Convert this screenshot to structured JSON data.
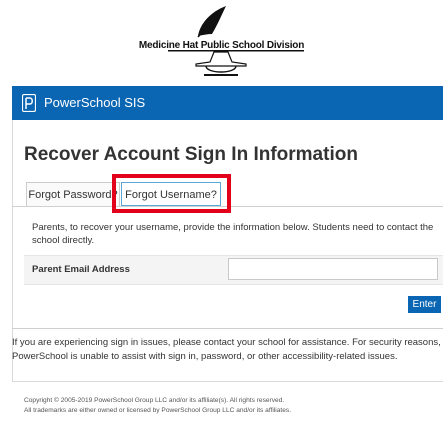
{
  "district": {
    "name": "Medicine Hat Public School Division"
  },
  "header": {
    "brand": "PowerSchool SIS"
  },
  "page": {
    "title": "Recover Account Sign In Information"
  },
  "tabs": [
    {
      "label": "Forgot Password?"
    },
    {
      "label": "Forgot Username?"
    }
  ],
  "form": {
    "instructions": "Parents, to recover your username, provide the information below. Students need to contact the school directly.",
    "email_label": "Parent Email Address",
    "email_value": "",
    "enter_label": "Enter"
  },
  "notice": "If you are experiencing sign in issues, please contact your school for assistance. For security reasons, PowerSchool is unable to assist with sign in, password, or other accessibility-related issues.",
  "footer": {
    "copyright": "Copyright © 2005-2019 PowerSchool Group LLC and/or its affiliate(s). All rights reserved.",
    "trademarks": "All trademarks are either owned or licensed by PowerSchool Group LLC and/or its affiliates."
  },
  "colors": {
    "header": "#0a66b3",
    "highlight": "#e2001a"
  }
}
